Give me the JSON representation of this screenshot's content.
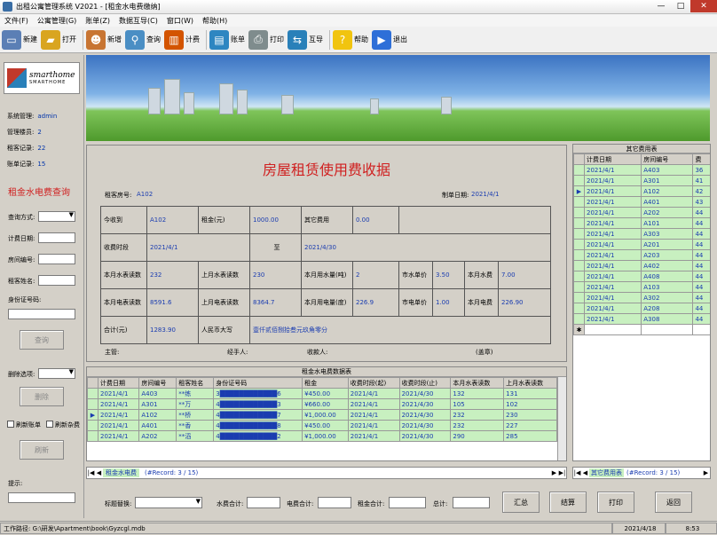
{
  "window": {
    "title": "出租公寓管理系统 V2021 - [租金水电费缴纳]",
    "min": "—",
    "max": "□",
    "close": "✕"
  },
  "menu": [
    "文件(F)",
    "公寓管理(G)",
    "账单(Z)",
    "数据互导(C)",
    "窗口(W)",
    "帮助(H)"
  ],
  "toolbar": [
    {
      "label": "新建",
      "icon": "new-icon",
      "sym": "▭",
      "color": "#5b7fb5"
    },
    {
      "label": "打开",
      "icon": "folder-icon",
      "sym": "▰",
      "color": "#d9a520"
    },
    {
      "label": "新增",
      "icon": "add-user-icon",
      "sym": "☻",
      "color": "#c87533"
    },
    {
      "label": "查询",
      "icon": "search-icon",
      "sym": "⚲",
      "color": "#4a8ec4"
    },
    {
      "label": "计费",
      "icon": "chart-icon",
      "sym": "▥",
      "color": "#d35400"
    },
    {
      "label": "账单",
      "icon": "bill-icon",
      "sym": "▤",
      "color": "#2e86c1"
    },
    {
      "label": "打印",
      "icon": "printer-icon",
      "sym": "⎙",
      "color": "#7f8c8d"
    },
    {
      "label": "互导",
      "icon": "transfer-icon",
      "sym": "⇆",
      "color": "#2980b9"
    },
    {
      "label": "帮助",
      "icon": "help-icon",
      "sym": "?",
      "color": "#f1c40f"
    },
    {
      "label": "退出",
      "icon": "exit-icon",
      "sym": "▶",
      "color": "#2e6fd8"
    }
  ],
  "logo": {
    "line1": "smarthome",
    "line2": "SMARTHOME"
  },
  "sysinfo": [
    {
      "label": "系统管理:",
      "value": "admin"
    },
    {
      "label": "管理楼员:",
      "value": "2"
    },
    {
      "label": "租客记录:",
      "value": "22"
    },
    {
      "label": "账单记录:",
      "value": "15"
    }
  ],
  "query": {
    "title": "租金水电费查询",
    "mode_label": "查询方式:",
    "date_label": "计费日期:",
    "room_label": "房间编号:",
    "name_label": "租客姓名:",
    "id_label": "身份证号码:",
    "query_btn": "查询",
    "delete_label": "删除选项:",
    "delete_btn": "删除",
    "cb_bill": "刷新账单",
    "cb_misc": "刷新杂费",
    "refresh_btn": "刷新",
    "hint_label": "提示:"
  },
  "form": {
    "title": "房屋租赁使用费收据",
    "room_label": "租客房号:",
    "room": "A102",
    "date_label": "制单日期:",
    "date": "2021/4/1",
    "rows": [
      [
        "今收到",
        "A102",
        "租金(元)",
        "1000.00",
        "其它费用",
        "0.00",
        "",
        "",
        ""
      ],
      [
        "收费时段",
        "2021/4/1",
        "",
        "至",
        "2021/4/30",
        "",
        "",
        "",
        ""
      ],
      [
        "本月水表读数",
        "232",
        "上月水表读数",
        "230",
        "本月用水量(吨)",
        "2",
        "市水单价",
        "3.50",
        "本月水费",
        "7.00"
      ],
      [
        "本月电表读数",
        "8591.6",
        "上月电表读数",
        "8364.7",
        "本月用电量(度)",
        "226.9",
        "市电单价",
        "1.00",
        "本月电费",
        "226.90"
      ],
      [
        "合计(元)",
        "1283.90",
        "人民币大写",
        "壹仟贰佰捌拾叁元玖角零分"
      ]
    ],
    "sign": [
      {
        "label": "主管:"
      },
      {
        "label": "经手人:"
      },
      {
        "label": "收款人:"
      },
      {
        "label": "(盖章)"
      }
    ]
  },
  "grid_main": {
    "title": "租金水电费数据表",
    "headers": [
      "计费日期",
      "房间编号",
      "租客姓名",
      "身份证号码",
      "租金",
      "收费时段(起)",
      "收费时段(止)",
      "本月水表读数",
      "上月水表读数"
    ],
    "rows": [
      [
        "2021/4/1",
        "A403",
        "**练",
        "3████████████6",
        "¥450.00",
        "2021/4/1",
        "2021/4/30",
        "132",
        "131"
      ],
      [
        "2021/4/1",
        "A301",
        "**万",
        "4████████████3",
        "¥660.00",
        "2021/4/1",
        "2021/4/30",
        "105",
        "102"
      ],
      [
        "2021/4/1",
        "A102",
        "**桥",
        "4████████████7",
        "¥1,000.00",
        "2021/4/1",
        "2021/4/30",
        "232",
        "230"
      ],
      [
        "2021/4/1",
        "A401",
        "**香",
        "4████████████8",
        "¥450.00",
        "2021/4/1",
        "2021/4/30",
        "232",
        "227"
      ],
      [
        "2021/4/1",
        "A202",
        "**滔",
        "4████████████2",
        "¥1,000.00",
        "2021/4/1",
        "2021/4/30",
        "290",
        "285"
      ]
    ],
    "nav_label": "租金水电费",
    "record": "(#Record: 3 / 15)"
  },
  "grid_other": {
    "title": "其它费用表",
    "headers": [
      "计费日期",
      "房间编号",
      "费"
    ],
    "rows": [
      [
        "2021/4/1",
        "A403",
        "36"
      ],
      [
        "2021/4/1",
        "A301",
        "41"
      ],
      [
        "2021/4/1",
        "A102",
        "42"
      ],
      [
        "2021/4/1",
        "A401",
        "43"
      ],
      [
        "2021/4/1",
        "A202",
        "44"
      ],
      [
        "2021/4/1",
        "A101",
        "44"
      ],
      [
        "2021/4/1",
        "A303",
        "44"
      ],
      [
        "2021/4/1",
        "A201",
        "44"
      ],
      [
        "2021/4/1",
        "A203",
        "44"
      ],
      [
        "2021/4/1",
        "A402",
        "44"
      ],
      [
        "2021/4/1",
        "A408",
        "44"
      ],
      [
        "2021/4/1",
        "A103",
        "44"
      ],
      [
        "2021/4/1",
        "A302",
        "44"
      ],
      [
        "2021/4/1",
        "A208",
        "44"
      ],
      [
        "2021/4/1",
        "A308",
        "44"
      ]
    ],
    "nav_label": "其它费用表",
    "record": "(#Record: 3 / 15)",
    "new_row": "✱"
  },
  "bottom": {
    "replace_label": "标题替换:",
    "water_label": "水费合计:",
    "elec_label": "电费合计:",
    "rent_label": "租金合计:",
    "total_label": "总计:",
    "sum_btn": "汇总",
    "settle_btn": "结算",
    "print_btn": "打印",
    "back_btn": "返回"
  },
  "status": {
    "path": "工作路径: G:\\研发\\Apartment\\book\\Gyzcgl.mdb",
    "date": "2021/4/18",
    "time": "8:53"
  }
}
